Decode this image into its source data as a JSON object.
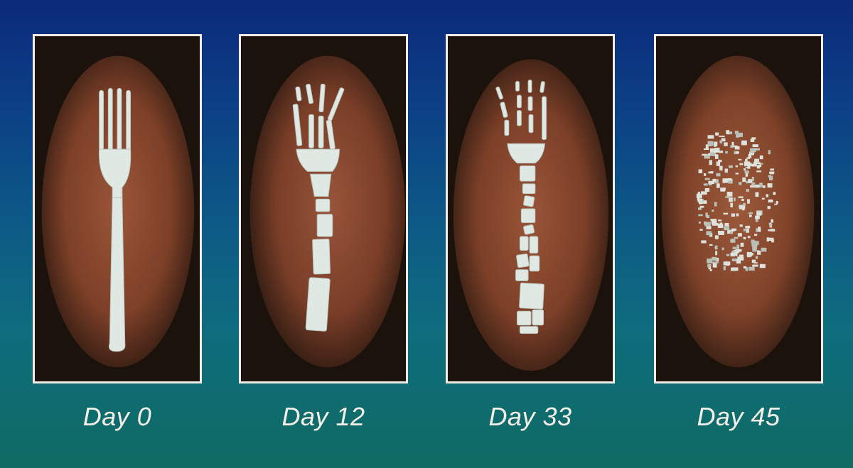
{
  "panels": [
    {
      "label": "Day 0",
      "stage": "intact-fork"
    },
    {
      "label": "Day 12",
      "stage": "cracked-fork"
    },
    {
      "label": "Day 33",
      "stage": "fragmented-fork"
    },
    {
      "label": "Day 45",
      "stage": "granulated-pile"
    }
  ],
  "colors": {
    "background_top": "#0b2a7a",
    "background_bottom": "#0f6b62",
    "soil_dark": "#1c120c",
    "soil_clay": "#8a4a30",
    "fork": "#dfe8e2",
    "frame": "#f2ece4",
    "caption": "#f4f0e8"
  }
}
